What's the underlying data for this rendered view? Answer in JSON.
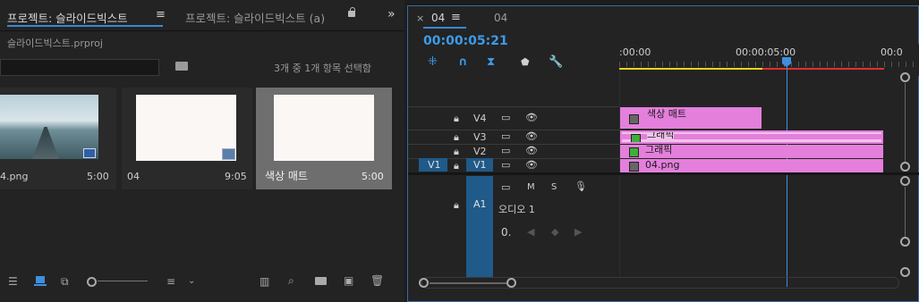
{
  "project_panel": {
    "tab_active": "프로젝트: 슬라이드빅스트",
    "tab_inactive": "프로젝트: 슬라이드빅스트 (a)",
    "file_name": "슬라이드빅스트.prproj",
    "selection_info": "3개 중 1개 항목 선택함",
    "items": [
      {
        "name": "4.png",
        "duration": "5:00"
      },
      {
        "name": "04",
        "duration": "9:05"
      },
      {
        "name": "색상 매트",
        "duration": "5:00"
      }
    ]
  },
  "sequence_panel": {
    "tab_active": "04",
    "tab_inactive": "04",
    "timecode": "00:00:05:21",
    "ruler_labels": [
      ":00:00",
      "00:00:05:00",
      "00:0"
    ],
    "tracks": {
      "V4": "V4",
      "V3": "V3",
      "V2": "V2",
      "V1": "V1",
      "V1_source": "V1",
      "A1": "A1",
      "audio_name": "오디오 1",
      "m": "M",
      "s": "S"
    },
    "clips": {
      "v4": "색상 매트",
      "v3": "그래픽",
      "v2": "그래픽",
      "v1": "04.png"
    }
  }
}
